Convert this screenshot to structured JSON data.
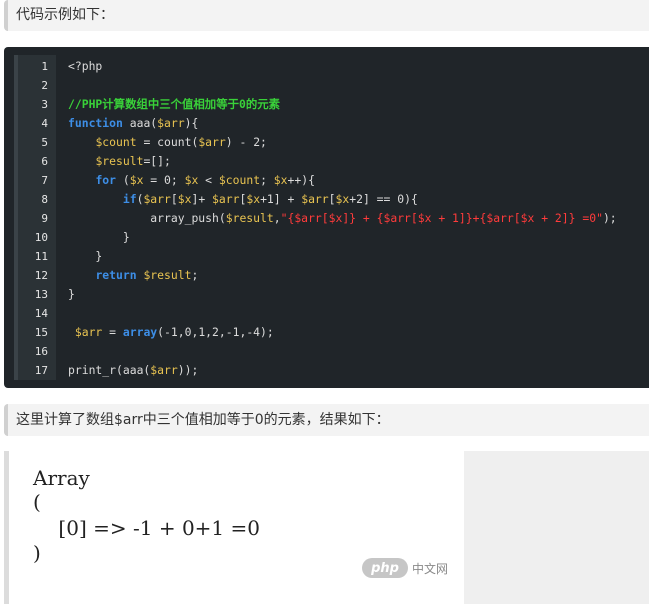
{
  "callouts": {
    "intro": "代码示例如下：",
    "result_intro": "这里计算了数组$arr中三个值相加等于0的元素，结果如下："
  },
  "code": {
    "line_numbers": [
      "1",
      "2",
      "3",
      "4",
      "5",
      "6",
      "7",
      "8",
      "9",
      "10",
      "11",
      "12",
      "13",
      "14",
      "15",
      "16",
      "17"
    ],
    "lines": [
      [
        {
          "t": "<?php",
          "c": "def"
        }
      ],
      [],
      [
        {
          "t": "//PHP计算数组中三个值相加等于0的元素",
          "c": "cmt"
        }
      ],
      [
        {
          "t": "function ",
          "c": "kw"
        },
        {
          "t": "aaa(",
          "c": "def"
        },
        {
          "t": "$arr",
          "c": "var"
        },
        {
          "t": "){",
          "c": "def"
        }
      ],
      [
        {
          "t": "    ",
          "c": "def"
        },
        {
          "t": "$count",
          "c": "var"
        },
        {
          "t": " = count(",
          "c": "def"
        },
        {
          "t": "$arr",
          "c": "var"
        },
        {
          "t": ") - 2;",
          "c": "def"
        }
      ],
      [
        {
          "t": "    ",
          "c": "def"
        },
        {
          "t": "$result",
          "c": "var"
        },
        {
          "t": "=[];",
          "c": "def"
        }
      ],
      [
        {
          "t": "    ",
          "c": "def"
        },
        {
          "t": "for",
          "c": "kw"
        },
        {
          "t": " (",
          "c": "def"
        },
        {
          "t": "$x",
          "c": "var"
        },
        {
          "t": " = 0; ",
          "c": "def"
        },
        {
          "t": "$x",
          "c": "var"
        },
        {
          "t": " < ",
          "c": "def"
        },
        {
          "t": "$count",
          "c": "var"
        },
        {
          "t": "; ",
          "c": "def"
        },
        {
          "t": "$x",
          "c": "var"
        },
        {
          "t": "++){",
          "c": "def"
        }
      ],
      [
        {
          "t": "        ",
          "c": "def"
        },
        {
          "t": "if",
          "c": "kw"
        },
        {
          "t": "(",
          "c": "def"
        },
        {
          "t": "$arr",
          "c": "var"
        },
        {
          "t": "[",
          "c": "def"
        },
        {
          "t": "$x",
          "c": "var"
        },
        {
          "t": "]+ ",
          "c": "def"
        },
        {
          "t": "$arr",
          "c": "var"
        },
        {
          "t": "[",
          "c": "def"
        },
        {
          "t": "$x",
          "c": "var"
        },
        {
          "t": "+1] + ",
          "c": "def"
        },
        {
          "t": "$arr",
          "c": "var"
        },
        {
          "t": "[",
          "c": "def"
        },
        {
          "t": "$x",
          "c": "var"
        },
        {
          "t": "+2] == 0){",
          "c": "def"
        }
      ],
      [
        {
          "t": "            array_push(",
          "c": "def"
        },
        {
          "t": "$result",
          "c": "var"
        },
        {
          "t": ",",
          "c": "def"
        },
        {
          "t": "\"{$arr[$x]} + {$arr[$x + 1]}+{$arr[$x + 2]} =0\"",
          "c": "str"
        },
        {
          "t": ");",
          "c": "def"
        }
      ],
      [
        {
          "t": "        }",
          "c": "def"
        }
      ],
      [
        {
          "t": "    }",
          "c": "def"
        }
      ],
      [
        {
          "t": "    ",
          "c": "def"
        },
        {
          "t": "return",
          "c": "kw"
        },
        {
          "t": " ",
          "c": "def"
        },
        {
          "t": "$result",
          "c": "var"
        },
        {
          "t": ";",
          "c": "def"
        }
      ],
      [
        {
          "t": "}",
          "c": "def"
        }
      ],
      [],
      [
        {
          "t": " ",
          "c": "def"
        },
        {
          "t": "$arr",
          "c": "var"
        },
        {
          "t": " = ",
          "c": "def"
        },
        {
          "t": "array",
          "c": "kw"
        },
        {
          "t": "(-1,0,1,2,-1,-4);",
          "c": "def"
        }
      ],
      [],
      [
        {
          "t": "print_r(aaa(",
          "c": "def"
        },
        {
          "t": "$arr",
          "c": "var"
        },
        {
          "t": "));",
          "c": "def"
        }
      ]
    ]
  },
  "output": {
    "lines": [
      "Array",
      "(",
      "    [0] => -1 + 0+1 =0",
      ")"
    ]
  },
  "watermark": {
    "logo": "php",
    "site": "中文网"
  }
}
